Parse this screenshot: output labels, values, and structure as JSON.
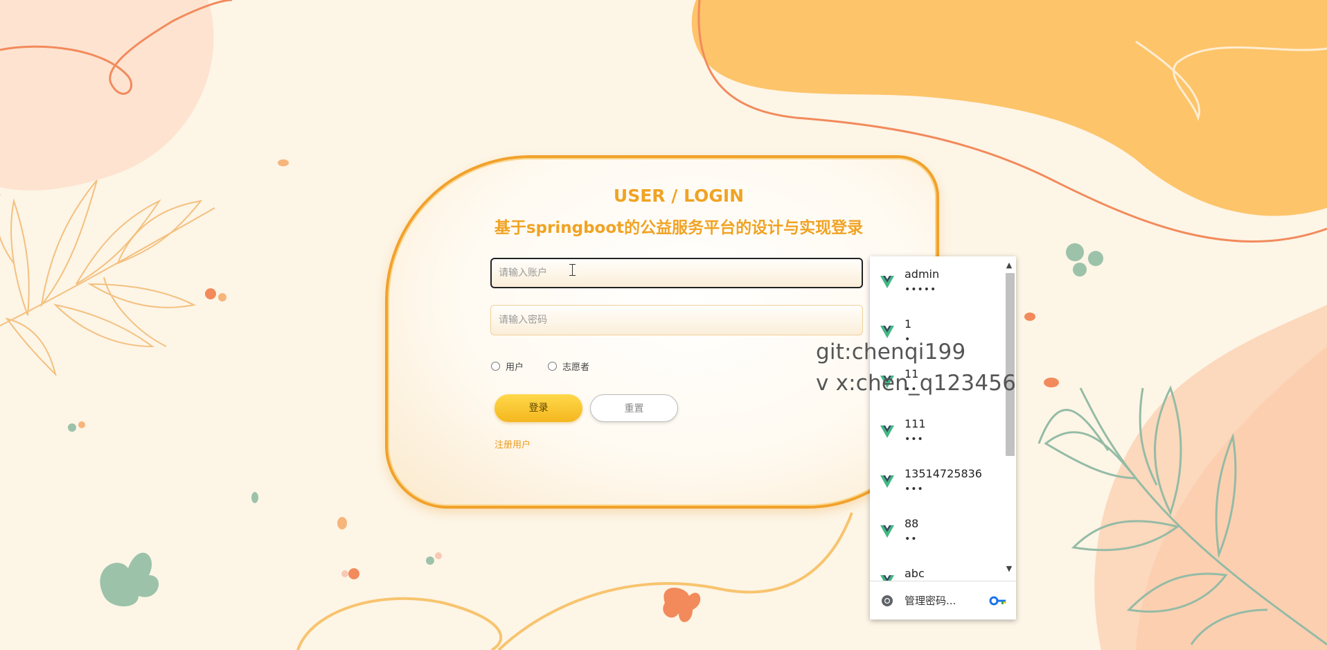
{
  "login": {
    "title_en": "USER / LOGIN",
    "title_cn": "基于springboot的公益服务平台的设计与实现登录",
    "account_placeholder": "请输入账户",
    "password_placeholder": "请输入密码",
    "roles": [
      "用户",
      "志愿者"
    ],
    "login_button": "登录",
    "reset_button": "重置",
    "register_link": "注册用户"
  },
  "watermark": {
    "line1": "git:chenqi199",
    "line2": "v x:chen_q123456"
  },
  "password_popup": {
    "items": [
      {
        "username": "admin",
        "password_mask": "•••••"
      },
      {
        "username": "1",
        "password_mask": "•"
      },
      {
        "username": "11",
        "password_mask": "••"
      },
      {
        "username": "111",
        "password_mask": "•••"
      },
      {
        "username": "13514725836",
        "password_mask": "•••"
      },
      {
        "username": "88",
        "password_mask": "••"
      },
      {
        "username": "abc",
        "password_mask": "•••"
      }
    ],
    "manage_label": "管理密码...",
    "scroll_up": "▲",
    "scroll_down": "▼"
  },
  "colors": {
    "accent": "#f0a324",
    "background": "#fdf5e6",
    "vue_green": "#41b883",
    "vue_dark": "#35495e"
  }
}
